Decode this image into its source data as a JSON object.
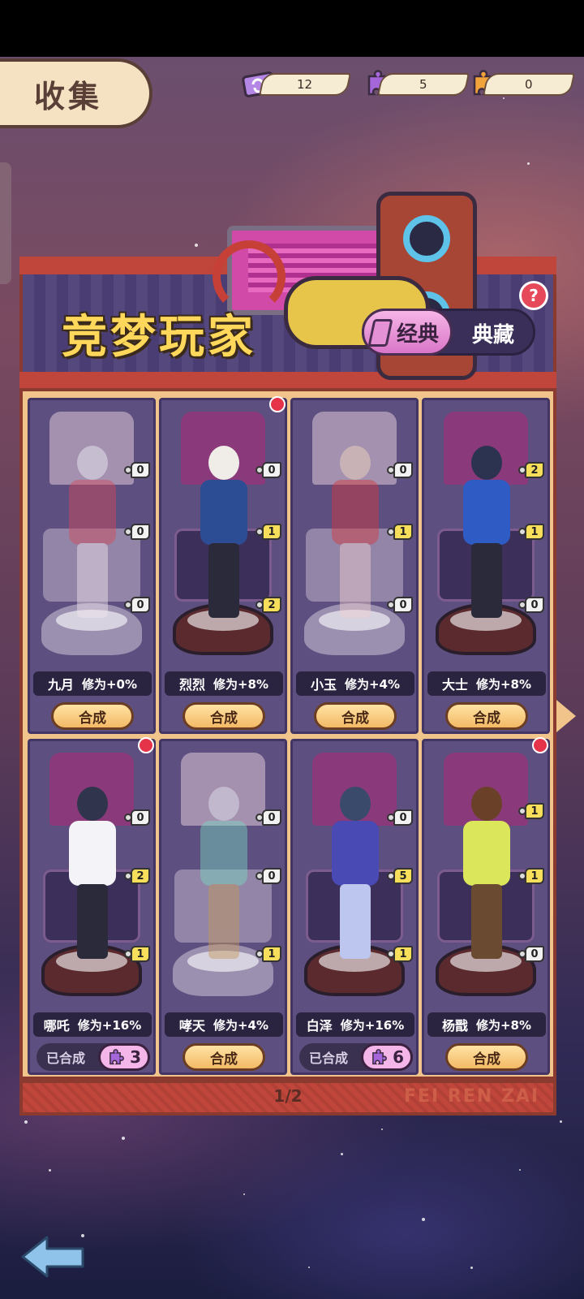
{
  "header": {
    "title": "收集",
    "resources": [
      {
        "icon": "ticket-icon",
        "value": "12"
      },
      {
        "icon": "purple-puzzle-icon",
        "value": "5"
      },
      {
        "icon": "orange-puzzle-icon",
        "value": "0"
      }
    ]
  },
  "banner": {
    "title": "竞梦玩家",
    "tabs": {
      "active": "经典",
      "inactive": "典藏"
    },
    "help": "?"
  },
  "cards": [
    {
      "name": "九月",
      "bonus": "修为+0%",
      "counts": [
        "0",
        "0",
        "0"
      ],
      "action": "合成",
      "synthesized": false,
      "badge": false
    },
    {
      "name": "烈烈",
      "bonus": "修为+8%",
      "counts": [
        "0",
        "1",
        "2"
      ],
      "action": "合成",
      "synthesized": false,
      "badge": true
    },
    {
      "name": "小玉",
      "bonus": "修为+4%",
      "counts": [
        "0",
        "1",
        "0"
      ],
      "action": "合成",
      "synthesized": false,
      "badge": false
    },
    {
      "name": "大士",
      "bonus": "修为+8%",
      "counts": [
        "2",
        "1",
        "0"
      ],
      "action": "合成",
      "synthesized": false,
      "badge": false
    },
    {
      "name": "哪吒",
      "bonus": "修为+16%",
      "counts": [
        "0",
        "2",
        "1"
      ],
      "action": "已合成",
      "synthesized": true,
      "owned": "3",
      "badge": true
    },
    {
      "name": "哮天",
      "bonus": "修为+4%",
      "counts": [
        "0",
        "0",
        "1"
      ],
      "action": "合成",
      "synthesized": false,
      "badge": false
    },
    {
      "name": "白泽",
      "bonus": "修为+16%",
      "counts": [
        "0",
        "5",
        "1"
      ],
      "action": "已合成",
      "synthesized": true,
      "owned": "6",
      "badge": false
    },
    {
      "name": "杨戬",
      "bonus": "修为+8%",
      "counts": [
        "1",
        "1",
        "0"
      ],
      "action": "合成",
      "synthesized": false,
      "badge": true
    }
  ],
  "pagination": {
    "text": "1/2"
  },
  "watermark": "FEI REN ZAI",
  "colors": {
    "accent": "#f0c48a",
    "banner": "#4a3d74",
    "title": "#ffd75a",
    "badge": "#e5344a"
  }
}
